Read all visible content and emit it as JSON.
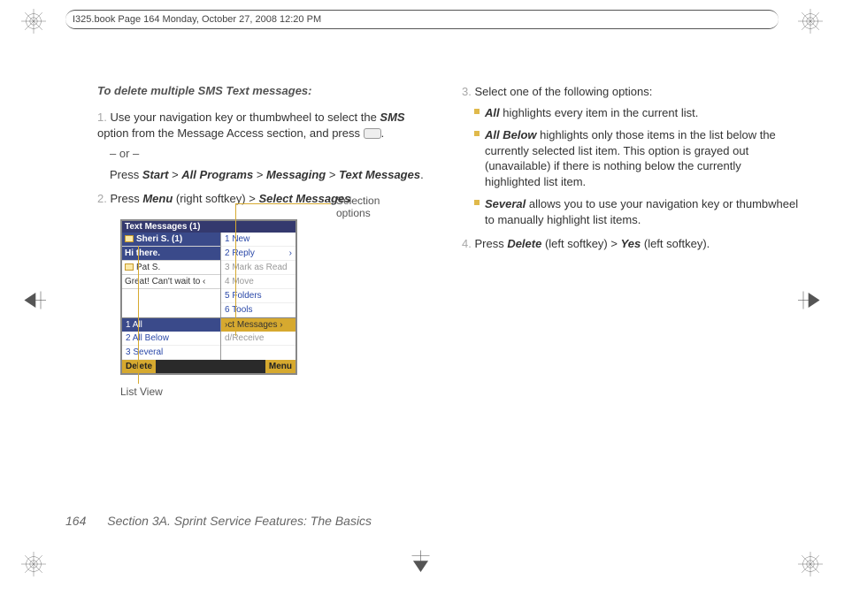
{
  "meta_header": "I325.book  Page 164  Monday, October 27, 2008  12:20 PM",
  "page_number": "164",
  "footer_section": "Section 3A. Sprint Service Features: The Basics",
  "heading": "To delete multiple SMS Text messages:",
  "steps": {
    "s1_num": "1.",
    "s1_a": "Use your navigation key or thumbwheel to select the ",
    "s1_sms": "SMS",
    "s1_b": " option from the Message Access section, and press ",
    "s1_or": "– or –",
    "s1_press": "Press ",
    "s1_start": "Start",
    "s1_gt1": " > ",
    "s1_allprog": "All Programs",
    "s1_gt2": " > ",
    "s1_msg": "Messaging",
    "s1_gt3": " > ",
    "s1_txt": "Text Messages",
    "s1_dot": ".",
    "s2_num": "2.",
    "s2_a": "Press ",
    "s2_menu": "Menu",
    "s2_b": " (right softkey) ",
    "s2_gt": "> ",
    "s2_sel": "Select Messages",
    "s2_dot": ".",
    "s3_num": "3.",
    "s3_a": "Select one of the following options:",
    "s3_all": "All",
    "s3_all_t": " highlights every item in the current list.",
    "s3_ab": "All Below",
    "s3_ab_t": " highlights only those items in the list below the currently selected list item. This option is grayed out (unavailable) if there is nothing below the currently highlighted list item.",
    "s3_sv": "Several",
    "s3_sv_t": " allows you to use your navigation key or thumbwheel to manually highlight list items.",
    "s4_num": "4.",
    "s4_a": "Press ",
    "s4_del": "Delete",
    "s4_b": " (left softkey) ",
    "s4_gt": "> ",
    "s4_yes": "Yes",
    "s4_c": " (left softkey)."
  },
  "phone": {
    "title": "Text Messages (1)",
    "row1_sender": "Sheri S. (1)",
    "row1_preview": "Hi there.",
    "row2_sender": "Pat S.",
    "row2_preview": "Great! Can't wait to ‹",
    "menu1": "1 New",
    "menu2": "2 Reply",
    "menu3": "3 Mark as Read",
    "menu4": "4 Move",
    "menu5": "5 Folders",
    "menu6": "6 Tools",
    "sub_sel_header": "›ct Messages  ›",
    "sub_sendrecv": "d/Receive",
    "sub1": "1 All",
    "sub2": "2 All Below",
    "sub3": "3 Several",
    "delete_key": "Delete",
    "menu_key": "Menu"
  },
  "callouts": {
    "selection": "Selection options",
    "listview": "List View"
  }
}
